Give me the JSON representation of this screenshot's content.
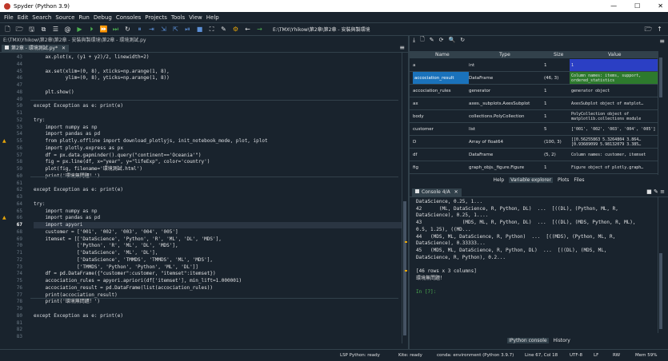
{
  "window": {
    "title": "Spyder (Python 3.9)",
    "controls": [
      "—",
      "☐",
      "✕"
    ]
  },
  "menu": [
    "File",
    "Edit",
    "Search",
    "Source",
    "Run",
    "Debug",
    "Consoles",
    "Projects",
    "Tools",
    "View",
    "Help"
  ],
  "toolbar": {
    "path": "E:\\TMX\\Yhikow\\第2章\\第2章 - 安裝與製環境"
  },
  "editor": {
    "filepath": "E:\\TMX\\Yhikow\\第2章\\第2章 - 安裝與製環境\\第2章 - 環境測試.py",
    "tab_label": "第2章 - 環境測試.py*",
    "tab_close": "✕",
    "menu_icon": "≡",
    "current_line": "67",
    "line_numbers": [
      "43",
      "44",
      "45",
      "46",
      "47",
      "48",
      "49",
      "50",
      "51",
      "52",
      "53",
      "54",
      "55",
      "56",
      "57",
      "58",
      "59",
      "60",
      "61",
      "62",
      "63",
      "64",
      "65",
      "66",
      "67",
      "68",
      "69",
      "70",
      "71",
      "72",
      "73",
      "74",
      "75",
      "76",
      "77",
      "78",
      "79",
      "80",
      "81",
      "82",
      "83"
    ],
    "lines": [
      "    ax.plot(x, (y1 + y2)/2, linewidth=2)",
      "",
      "    ax.set(xlim=(0, 8), xticks=np.arange(1, 8),",
      "           ylim=(0, 8), yticks=np.arange(1, 8))",
      "",
      "    plt.show()",
      "",
      "except Exception as e: print(e)",
      "",
      "try:",
      "    import numpy as np",
      "    import pandas as pd",
      "    from plotly.offline import download_plotlyjs, init_notebook_mode, plot, iplot",
      "    import plotly.express as px",
      "    df = px.data.gapminder().query(\"continent=='Oceania'\")",
      "    fig = px.line(df, x=\"year\", y=\"lifeExp\", color='country')",
      "    plot(fig, filename='環境測試.html')",
      "    print('環境無問題！')",
      "",
      "except Exception as e: print(e)",
      "",
      "try:",
      "    import numpy as np",
      "    import pandas as pd",
      "    import apyori",
      "    customer = ['001', '002', '003', '004', '005']",
      "    itemset = [['DataScience', 'Python', 'R', 'ML', 'DL', 'MDS'],",
      "               ['Python', 'R', 'ML', 'DL', 'MDS'],",
      "               ['DataScience', 'ML', 'DL'],",
      "               ['DataScience', 'TMMDS', 'TMMDS', 'ML', 'MDS'],",
      "               ['TMMDS', 'Python', 'Python', 'ML', 'DL']]",
      "    df = pd.DataFrame({\"customer\":customer, \"itemset\":itemset})",
      "    accociation_rules = apyori.apriori(df['itemset'], min_lift=1.000001)",
      "    accociation_result = pd.DataFrame(list(accociation_rules))",
      "    print(accociation_result)",
      "    print('環境無問題！')",
      "",
      "except Exception as e: print(e)",
      "",
      "",
      ""
    ]
  },
  "variable_explorer": {
    "toolbar_icons": [
      "⤓",
      "🗋",
      "✎",
      "⟳",
      "🔍",
      "↻"
    ],
    "menu_icon": "≡",
    "headers": [
      "Name",
      "Type",
      "Size",
      "Value"
    ],
    "rows": [
      {
        "name": "a",
        "type": "int",
        "size": "1",
        "value": "1"
      },
      {
        "name": "accociation_result",
        "type": "DataFrame",
        "size": "(46, 3)",
        "value": "Column names: items, support, ordered_statistics"
      },
      {
        "name": "accociation_rules",
        "type": "generator",
        "size": "1",
        "value": "generator object"
      },
      {
        "name": "ax",
        "type": "axes._subplots.AxesSubplot",
        "size": "1",
        "value": "AxesSubplot object of matplot…"
      },
      {
        "name": "body",
        "type": "collections.PolyCollection",
        "size": "1",
        "value": "PolyCollection object of matplotlib.collections module"
      },
      {
        "name": "customer",
        "type": "list",
        "size": "5",
        "value": "['001', '002', '003', '004', '005']"
      },
      {
        "name": "D",
        "type": "Array of float64",
        "size": "(100, 3)",
        "value": "[[0.56255863 5.3264804  3.864…  [0.93689099 5.98132079 3.385…"
      },
      {
        "name": "df",
        "type": "DataFrame",
        "size": "(5, 2)",
        "value": "Column names: customer, itemset"
      },
      {
        "name": "fig",
        "type": "graph_objs._figure.Figure",
        "size": "1",
        "value": "Figure object of plotly.graph…"
      }
    ],
    "tabs": [
      "Help",
      "Variable explorer",
      "Plots",
      "Files"
    ]
  },
  "console": {
    "tab_label": "Console 4/A",
    "tab_close": "✕",
    "icons": [
      "■",
      "✎",
      "≡"
    ],
    "lines": [
      "DataScience, 0.25, 1...",
      "42      (ML, DataScience, R, Python, DL)  ...  [((DL), (Python, ML, R,",
      "DataScience), 0.25, 1....",
      "43              (MDS, ML, R, Python, DL)  ...  [((DL), (MDS, Python, R, ML),",
      "0.5, 1.25), ((MD...",
      "44   (MDS, ML, DataScience, R, Python)  ...  [((MDS), (Python, ML, R,",
      "DataScience), 0.33333...",
      "45   (MDS, ML, DataScience, R, Python, DL)  ...  [((DL), (MDS, ML,",
      "DataScience, R, Python), 0.2...",
      "",
      "[46 rows x 3 columns]",
      "環境無問題！",
      "",
      "In [7]:"
    ],
    "tabs": [
      "IPython console",
      "History"
    ]
  },
  "statusbar": {
    "lsp": "LSP Python: ready",
    "kite": "Kite: ready",
    "conda": "conda: environment (Python 3.9.7)",
    "position": "Line 67, Col 18",
    "encoding": "UTF-8",
    "eol": "LF",
    "rw": "RW",
    "mem": "Mem 59%"
  },
  "colors": {
    "background": "#19232d",
    "accent": "#1a72bb",
    "warning": "#e5a50a",
    "keyword": "#c678dd",
    "value_green": "#2d7a2d"
  }
}
